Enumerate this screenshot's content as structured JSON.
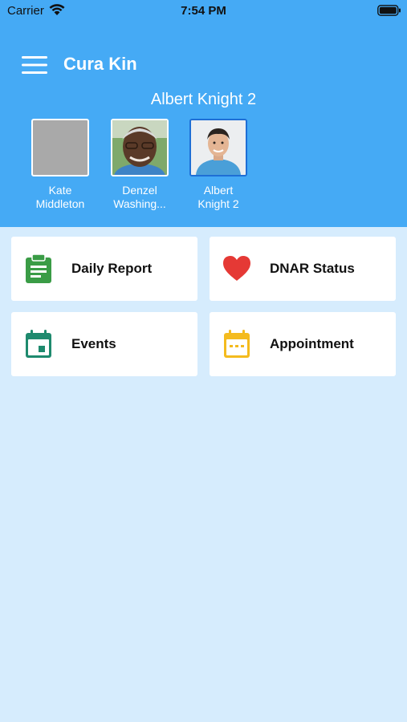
{
  "status_bar": {
    "carrier": "Carrier",
    "time": "7:54 PM"
  },
  "header": {
    "title": "Cura Kin",
    "selected_name": "Albert  Knight 2"
  },
  "profiles": [
    {
      "line1": "Kate",
      "line2": "Middleton",
      "selected": false
    },
    {
      "line1": "Denzel",
      "line2": "Washing...",
      "selected": false
    },
    {
      "line1": "Albert",
      "line2": "Knight 2",
      "selected": true
    }
  ],
  "tiles": [
    {
      "label": "Daily Report",
      "icon": "clipboard-icon",
      "color": "#3a9c46"
    },
    {
      "label": "DNAR Status",
      "icon": "heart-icon",
      "color": "#e53935"
    },
    {
      "label": "Events",
      "icon": "calendar-icon",
      "color": "#1e8a6e"
    },
    {
      "label": "Appointment",
      "icon": "calendar-dots-icon",
      "color": "#f4bb1e"
    }
  ],
  "colors": {
    "header": "#45aaf5",
    "background": "#d6ecfd"
  }
}
